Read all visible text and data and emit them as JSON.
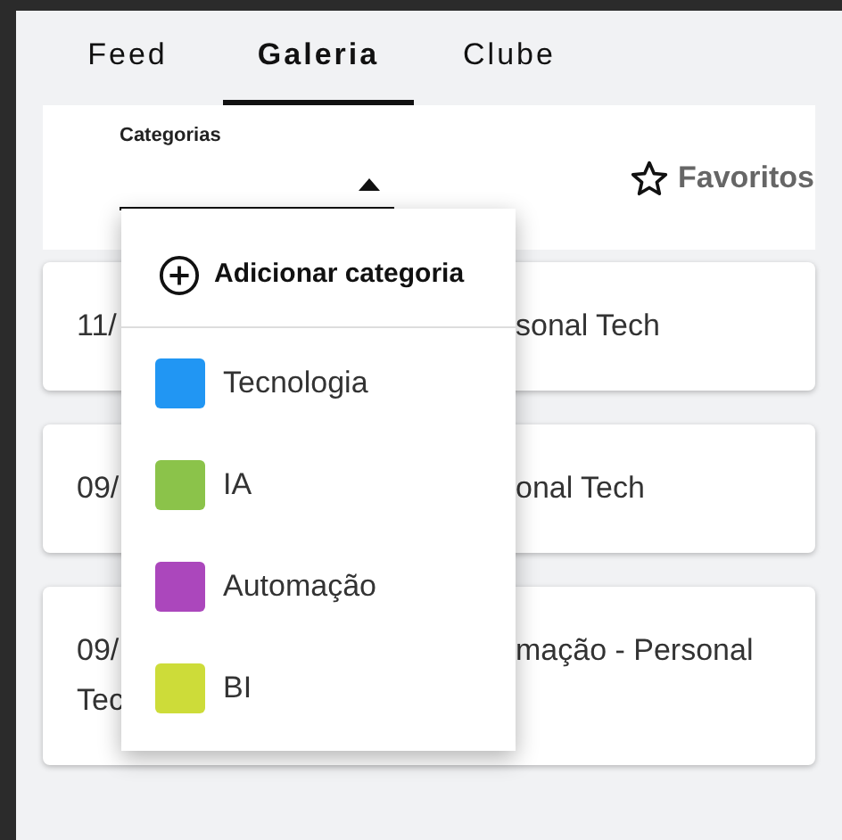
{
  "tabs": [
    {
      "label": "Feed",
      "selected": false
    },
    {
      "label": "Galeria",
      "selected": true
    },
    {
      "label": "Clube",
      "selected": false
    }
  ],
  "filter": {
    "label": "Categorias",
    "expanded": true,
    "favorites": "Favoritos"
  },
  "posts": [
    {
      "left": [
        "11/"
      ],
      "right": [
        "sonal Tech"
      ]
    },
    {
      "left": [
        "09/"
      ],
      "right": [
        "onal Tech"
      ]
    },
    {
      "left": [
        "09/",
        "Tec"
      ],
      "right": [
        "mação - Personal"
      ]
    }
  ],
  "menu": {
    "action": "Adicionar categoria",
    "items": [
      {
        "label": "Tecnologia",
        "color": "#2196f3"
      },
      {
        "label": "IA",
        "color": "#8bc34a"
      },
      {
        "label": "Automação",
        "color": "#ab47bc"
      },
      {
        "label": "BI",
        "color": "#cddc39"
      }
    ]
  }
}
